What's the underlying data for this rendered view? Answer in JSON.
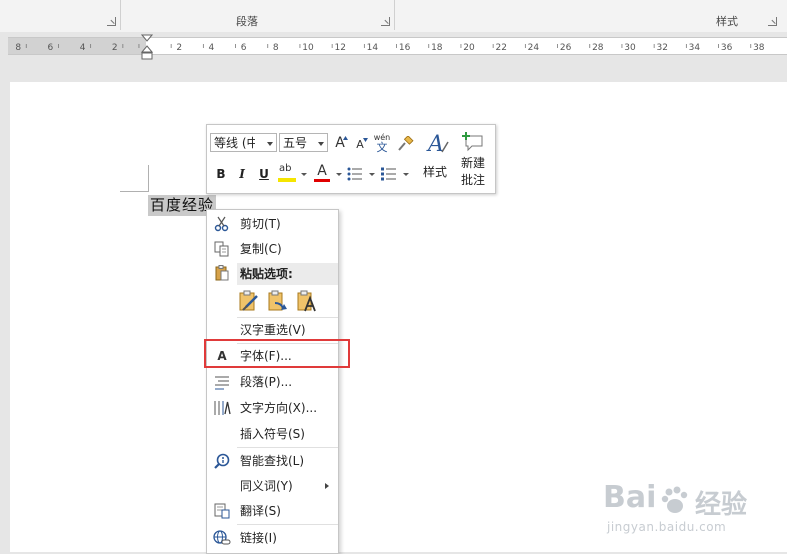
{
  "ribbon": {
    "paragraph_label": "段落",
    "styles_label": "样式"
  },
  "ruler": {
    "left_labels": [
      "8",
      "6",
      "4",
      "2"
    ],
    "right_labels": [
      "2",
      "4",
      "6",
      "8",
      "10",
      "12",
      "14",
      "16",
      "18",
      "20",
      "22",
      "24",
      "26",
      "28",
      "30",
      "32",
      "34",
      "36",
      "38"
    ]
  },
  "document": {
    "selected_text": "百度经验"
  },
  "mini_toolbar": {
    "font_name": "等线 (中文",
    "font_size": "五号",
    "grow_font": "A",
    "shrink_font": "A",
    "phonetic_top": "wén",
    "phonetic_bottom": "文",
    "bold": "B",
    "italic": "I",
    "underline": "U",
    "highlight": "ab",
    "font_color": "A",
    "styles_icon": "A",
    "styles_label": "样式",
    "new_comment_line1": "新建",
    "new_comment_line2": "批注",
    "highlight_color": "#f5e500",
    "font_color_value": "#e00000"
  },
  "context_menu": {
    "cut": "剪切(T)",
    "copy": "复制(C)",
    "paste_options": "粘贴选项:",
    "reconvert": "汉字重选(V)",
    "font": "字体(F)...",
    "font_icon": "A",
    "paragraph": "段落(P)...",
    "text_direction": "文字方向(X)...",
    "insert_symbol": "插入符号(S)",
    "smart_lookup": "智能查找(L)",
    "synonyms": "同义词(Y)",
    "translate": "翻译(S)",
    "link": "链接(I)"
  },
  "watermark": {
    "brand": "Bai",
    "brand_tail": "经验",
    "url": "jingyan.baidu.com"
  },
  "colors": {
    "highlight_box": "#e03a3a",
    "accent_blue": "#2b5797"
  }
}
